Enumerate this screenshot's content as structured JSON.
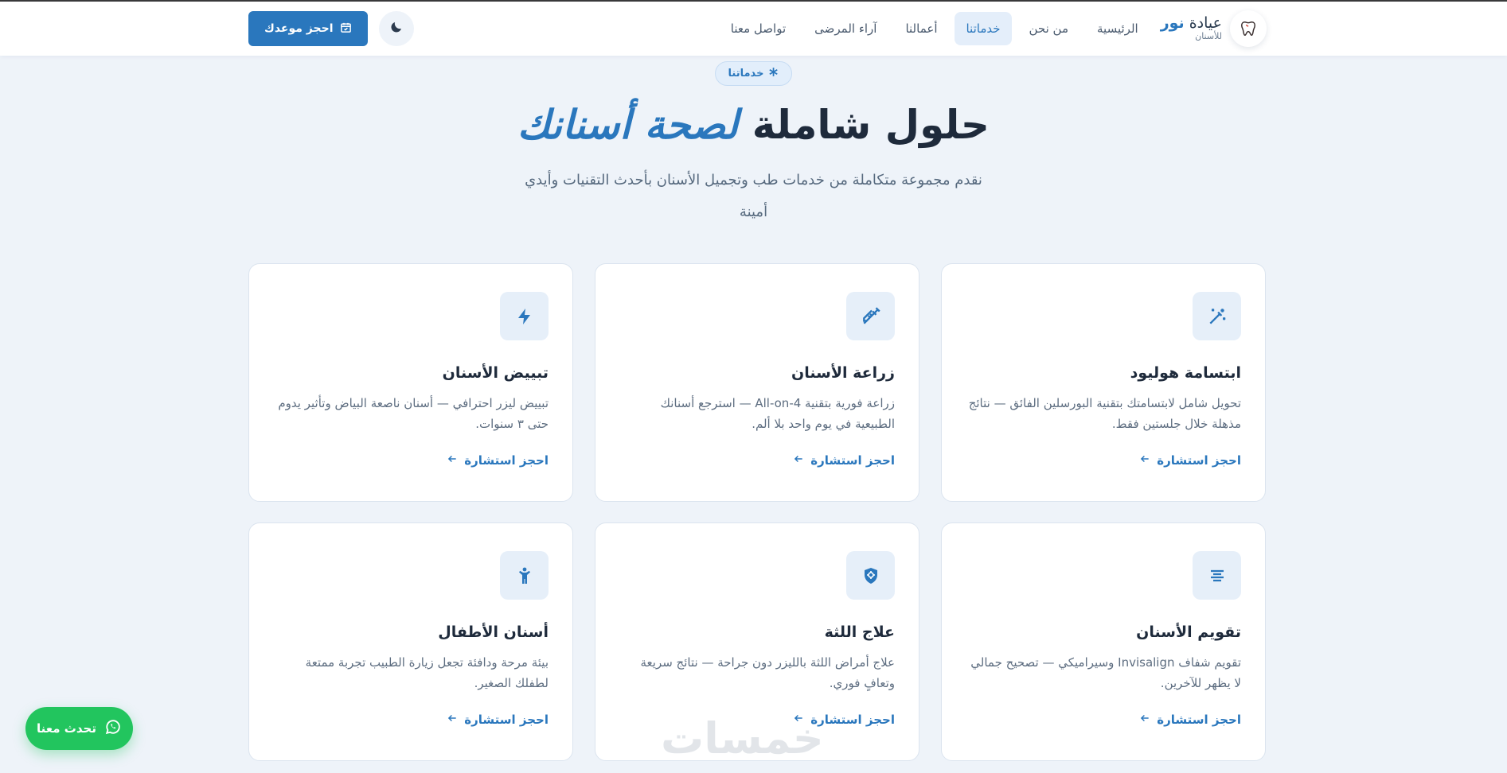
{
  "brand": {
    "name_prefix": "عيادة",
    "name_accent": "نور",
    "subtitle": "للأسنان",
    "logo_icon": "tooth-icon"
  },
  "nav": {
    "items": [
      {
        "label": "الرئيسية",
        "active": false
      },
      {
        "label": "من نحن",
        "active": false
      },
      {
        "label": "خدماتنا",
        "active": true
      },
      {
        "label": "أعمالنا",
        "active": false
      },
      {
        "label": "آراء المرضى",
        "active": false
      },
      {
        "label": "تواصل معنا",
        "active": false
      }
    ],
    "theme_icon": "moon-icon",
    "book_label": "احجز موعدك",
    "book_icon": "calendar-check-icon"
  },
  "section": {
    "chip_label": "خدماتنا",
    "chip_icon": "asterisk-icon",
    "title_plain": "حلول شاملة",
    "title_highlight": "لصحة أسنانك",
    "subtitle": "نقدم مجموعة متكاملة من خدمات طب وتجميل الأسنان بأحدث التقنيات وأيدي أمينة"
  },
  "cards": [
    {
      "icon": "magic-wand-icon",
      "title": "ابتسامة هوليود",
      "desc": "تحويل شامل لابتسامتك بتقنية البورسلين الفائق — نتائج مذهلة خلال جلستين فقط.",
      "link": "احجز استشارة"
    },
    {
      "icon": "syringe-icon",
      "title": "زراعة الأسنان",
      "desc": "زراعة فورية بتقنية All-on-4 — استرجع أسنانك الطبيعية في يوم واحد بلا ألم.",
      "link": "احجز استشارة"
    },
    {
      "icon": "bolt-icon",
      "title": "تبييض الأسنان",
      "desc": "تبييض ليزر احترافي — أسنان ناصعة البياض وتأثير يدوم حتى ٣ سنوات.",
      "link": "احجز استشارة"
    },
    {
      "icon": "align-center-icon",
      "title": "تقويم الأسنان",
      "desc": "تقويم شفاف Invisalign وسيراميكي — تصحيح جمالي لا يظهر للآخرين.",
      "link": "احجز استشارة"
    },
    {
      "icon": "shield-icon",
      "title": "علاج اللثة",
      "desc": "علاج أمراض اللثة بالليزر دون جراحة — نتائج سريعة وتعافٍ فوري.",
      "link": "احجز استشارة"
    },
    {
      "icon": "child-icon",
      "title": "أسنان الأطفال",
      "desc": "بيئة مرحة ودافئة تجعل زيارة الطبيب تجربة ممتعة لطفلك الصغير.",
      "link": "احجز استشارة"
    }
  ],
  "chat": {
    "label": "تحدث معنا",
    "icon": "whatsapp-icon"
  },
  "watermark": "خمسات",
  "colors": {
    "primary": "#2a77bd",
    "background": "#eef3f9",
    "whatsapp": "#22c55e"
  }
}
